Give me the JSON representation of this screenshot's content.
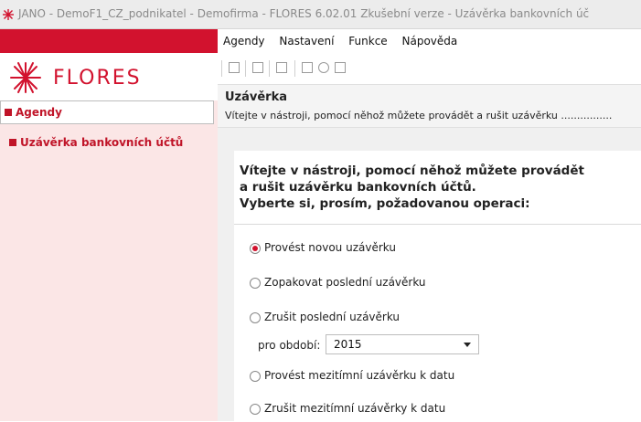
{
  "window": {
    "title": "JANO - DemoF1_CZ_podnikatel - Demofirma - FLORES 6.02.01 Zkušební verze - Uzávěrka bankovních úč",
    "icon": "flores-asterisk-icon"
  },
  "menu": {
    "items": [
      {
        "label": "Agendy",
        "name": "menu-agendy"
      },
      {
        "label": "Nastavení",
        "name": "menu-nastaveni"
      },
      {
        "label": "Funkce",
        "name": "menu-funkce"
      },
      {
        "label": "Nápověda",
        "name": "menu-napoveda"
      }
    ]
  },
  "sidebar": {
    "logo_text": "FLORES",
    "agendy_label": "Agendy",
    "nav_item_label": "Uzávěrka bankovních účtů"
  },
  "toolbar": {
    "icons": [
      "open-icon",
      "close-icon",
      "list-icon",
      "help-icon",
      "chat-icon",
      "info-icon"
    ]
  },
  "header": {
    "title": "Uzávěrka",
    "subtitle": "Vítejte v nástroji, pomocí něhož můžete provádět a rušit uzávěrku ................"
  },
  "main": {
    "heading_line1": "Vítejte v nástroji, pomocí něhož můžete provádět",
    "heading_line2": "a rušit uzávěrku bankovních účtů.",
    "heading_line3": "Vyberte si, prosím, požadovanou operaci:",
    "options": [
      {
        "label": "Provést novou uzávěrku",
        "selected": true
      },
      {
        "label": "Zopakovat poslední uzávěrku",
        "selected": false
      },
      {
        "label": "Zrušit poslední uzávěrku",
        "selected": false
      },
      {
        "label": "Provést mezitímní uzávěrku k datu",
        "selected": false
      },
      {
        "label": "Zrušit mezitímní uzávěrky k datu",
        "selected": false
      }
    ],
    "period_label": "pro období:",
    "period_value": "2015"
  },
  "colors": {
    "brand_red": "#d2122e",
    "sidebar_bg": "#fbe6e6"
  }
}
